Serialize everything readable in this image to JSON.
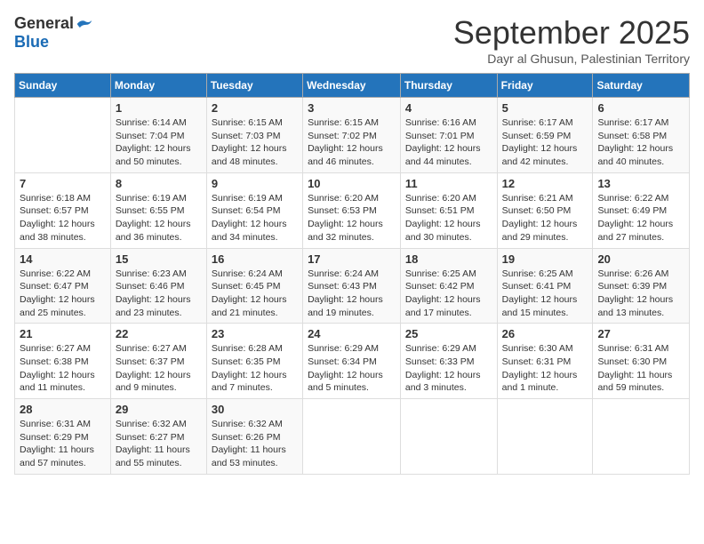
{
  "header": {
    "logo_general": "General",
    "logo_blue": "Blue",
    "month_title": "September 2025",
    "subtitle": "Dayr al Ghusun, Palestinian Territory"
  },
  "days_of_week": [
    "Sunday",
    "Monday",
    "Tuesday",
    "Wednesday",
    "Thursday",
    "Friday",
    "Saturday"
  ],
  "weeks": [
    [
      {
        "day": "",
        "sunrise": "",
        "sunset": "",
        "daylight": ""
      },
      {
        "day": "1",
        "sunrise": "Sunrise: 6:14 AM",
        "sunset": "Sunset: 7:04 PM",
        "daylight": "Daylight: 12 hours and 50 minutes."
      },
      {
        "day": "2",
        "sunrise": "Sunrise: 6:15 AM",
        "sunset": "Sunset: 7:03 PM",
        "daylight": "Daylight: 12 hours and 48 minutes."
      },
      {
        "day": "3",
        "sunrise": "Sunrise: 6:15 AM",
        "sunset": "Sunset: 7:02 PM",
        "daylight": "Daylight: 12 hours and 46 minutes."
      },
      {
        "day": "4",
        "sunrise": "Sunrise: 6:16 AM",
        "sunset": "Sunset: 7:01 PM",
        "daylight": "Daylight: 12 hours and 44 minutes."
      },
      {
        "day": "5",
        "sunrise": "Sunrise: 6:17 AM",
        "sunset": "Sunset: 6:59 PM",
        "daylight": "Daylight: 12 hours and 42 minutes."
      },
      {
        "day": "6",
        "sunrise": "Sunrise: 6:17 AM",
        "sunset": "Sunset: 6:58 PM",
        "daylight": "Daylight: 12 hours and 40 minutes."
      }
    ],
    [
      {
        "day": "7",
        "sunrise": "Sunrise: 6:18 AM",
        "sunset": "Sunset: 6:57 PM",
        "daylight": "Daylight: 12 hours and 38 minutes."
      },
      {
        "day": "8",
        "sunrise": "Sunrise: 6:19 AM",
        "sunset": "Sunset: 6:55 PM",
        "daylight": "Daylight: 12 hours and 36 minutes."
      },
      {
        "day": "9",
        "sunrise": "Sunrise: 6:19 AM",
        "sunset": "Sunset: 6:54 PM",
        "daylight": "Daylight: 12 hours and 34 minutes."
      },
      {
        "day": "10",
        "sunrise": "Sunrise: 6:20 AM",
        "sunset": "Sunset: 6:53 PM",
        "daylight": "Daylight: 12 hours and 32 minutes."
      },
      {
        "day": "11",
        "sunrise": "Sunrise: 6:20 AM",
        "sunset": "Sunset: 6:51 PM",
        "daylight": "Daylight: 12 hours and 30 minutes."
      },
      {
        "day": "12",
        "sunrise": "Sunrise: 6:21 AM",
        "sunset": "Sunset: 6:50 PM",
        "daylight": "Daylight: 12 hours and 29 minutes."
      },
      {
        "day": "13",
        "sunrise": "Sunrise: 6:22 AM",
        "sunset": "Sunset: 6:49 PM",
        "daylight": "Daylight: 12 hours and 27 minutes."
      }
    ],
    [
      {
        "day": "14",
        "sunrise": "Sunrise: 6:22 AM",
        "sunset": "Sunset: 6:47 PM",
        "daylight": "Daylight: 12 hours and 25 minutes."
      },
      {
        "day": "15",
        "sunrise": "Sunrise: 6:23 AM",
        "sunset": "Sunset: 6:46 PM",
        "daylight": "Daylight: 12 hours and 23 minutes."
      },
      {
        "day": "16",
        "sunrise": "Sunrise: 6:24 AM",
        "sunset": "Sunset: 6:45 PM",
        "daylight": "Daylight: 12 hours and 21 minutes."
      },
      {
        "day": "17",
        "sunrise": "Sunrise: 6:24 AM",
        "sunset": "Sunset: 6:43 PM",
        "daylight": "Daylight: 12 hours and 19 minutes."
      },
      {
        "day": "18",
        "sunrise": "Sunrise: 6:25 AM",
        "sunset": "Sunset: 6:42 PM",
        "daylight": "Daylight: 12 hours and 17 minutes."
      },
      {
        "day": "19",
        "sunrise": "Sunrise: 6:25 AM",
        "sunset": "Sunset: 6:41 PM",
        "daylight": "Daylight: 12 hours and 15 minutes."
      },
      {
        "day": "20",
        "sunrise": "Sunrise: 6:26 AM",
        "sunset": "Sunset: 6:39 PM",
        "daylight": "Daylight: 12 hours and 13 minutes."
      }
    ],
    [
      {
        "day": "21",
        "sunrise": "Sunrise: 6:27 AM",
        "sunset": "Sunset: 6:38 PM",
        "daylight": "Daylight: 12 hours and 11 minutes."
      },
      {
        "day": "22",
        "sunrise": "Sunrise: 6:27 AM",
        "sunset": "Sunset: 6:37 PM",
        "daylight": "Daylight: 12 hours and 9 minutes."
      },
      {
        "day": "23",
        "sunrise": "Sunrise: 6:28 AM",
        "sunset": "Sunset: 6:35 PM",
        "daylight": "Daylight: 12 hours and 7 minutes."
      },
      {
        "day": "24",
        "sunrise": "Sunrise: 6:29 AM",
        "sunset": "Sunset: 6:34 PM",
        "daylight": "Daylight: 12 hours and 5 minutes."
      },
      {
        "day": "25",
        "sunrise": "Sunrise: 6:29 AM",
        "sunset": "Sunset: 6:33 PM",
        "daylight": "Daylight: 12 hours and 3 minutes."
      },
      {
        "day": "26",
        "sunrise": "Sunrise: 6:30 AM",
        "sunset": "Sunset: 6:31 PM",
        "daylight": "Daylight: 12 hours and 1 minute."
      },
      {
        "day": "27",
        "sunrise": "Sunrise: 6:31 AM",
        "sunset": "Sunset: 6:30 PM",
        "daylight": "Daylight: 11 hours and 59 minutes."
      }
    ],
    [
      {
        "day": "28",
        "sunrise": "Sunrise: 6:31 AM",
        "sunset": "Sunset: 6:29 PM",
        "daylight": "Daylight: 11 hours and 57 minutes."
      },
      {
        "day": "29",
        "sunrise": "Sunrise: 6:32 AM",
        "sunset": "Sunset: 6:27 PM",
        "daylight": "Daylight: 11 hours and 55 minutes."
      },
      {
        "day": "30",
        "sunrise": "Sunrise: 6:32 AM",
        "sunset": "Sunset: 6:26 PM",
        "daylight": "Daylight: 11 hours and 53 minutes."
      },
      {
        "day": "",
        "sunrise": "",
        "sunset": "",
        "daylight": ""
      },
      {
        "day": "",
        "sunrise": "",
        "sunset": "",
        "daylight": ""
      },
      {
        "day": "",
        "sunrise": "",
        "sunset": "",
        "daylight": ""
      },
      {
        "day": "",
        "sunrise": "",
        "sunset": "",
        "daylight": ""
      }
    ]
  ]
}
